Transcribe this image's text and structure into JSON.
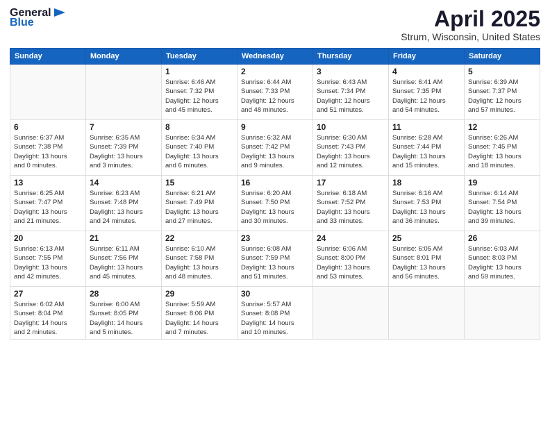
{
  "header": {
    "logo_general": "General",
    "logo_blue": "Blue",
    "title": "April 2025",
    "location": "Strum, Wisconsin, United States"
  },
  "weekdays": [
    "Sunday",
    "Monday",
    "Tuesday",
    "Wednesday",
    "Thursday",
    "Friday",
    "Saturday"
  ],
  "weeks": [
    [
      {
        "day": null,
        "info": null
      },
      {
        "day": null,
        "info": null
      },
      {
        "day": "1",
        "info": "Sunrise: 6:46 AM\nSunset: 7:32 PM\nDaylight: 12 hours\nand 45 minutes."
      },
      {
        "day": "2",
        "info": "Sunrise: 6:44 AM\nSunset: 7:33 PM\nDaylight: 12 hours\nand 48 minutes."
      },
      {
        "day": "3",
        "info": "Sunrise: 6:43 AM\nSunset: 7:34 PM\nDaylight: 12 hours\nand 51 minutes."
      },
      {
        "day": "4",
        "info": "Sunrise: 6:41 AM\nSunset: 7:35 PM\nDaylight: 12 hours\nand 54 minutes."
      },
      {
        "day": "5",
        "info": "Sunrise: 6:39 AM\nSunset: 7:37 PM\nDaylight: 12 hours\nand 57 minutes."
      }
    ],
    [
      {
        "day": "6",
        "info": "Sunrise: 6:37 AM\nSunset: 7:38 PM\nDaylight: 13 hours\nand 0 minutes."
      },
      {
        "day": "7",
        "info": "Sunrise: 6:35 AM\nSunset: 7:39 PM\nDaylight: 13 hours\nand 3 minutes."
      },
      {
        "day": "8",
        "info": "Sunrise: 6:34 AM\nSunset: 7:40 PM\nDaylight: 13 hours\nand 6 minutes."
      },
      {
        "day": "9",
        "info": "Sunrise: 6:32 AM\nSunset: 7:42 PM\nDaylight: 13 hours\nand 9 minutes."
      },
      {
        "day": "10",
        "info": "Sunrise: 6:30 AM\nSunset: 7:43 PM\nDaylight: 13 hours\nand 12 minutes."
      },
      {
        "day": "11",
        "info": "Sunrise: 6:28 AM\nSunset: 7:44 PM\nDaylight: 13 hours\nand 15 minutes."
      },
      {
        "day": "12",
        "info": "Sunrise: 6:26 AM\nSunset: 7:45 PM\nDaylight: 13 hours\nand 18 minutes."
      }
    ],
    [
      {
        "day": "13",
        "info": "Sunrise: 6:25 AM\nSunset: 7:47 PM\nDaylight: 13 hours\nand 21 minutes."
      },
      {
        "day": "14",
        "info": "Sunrise: 6:23 AM\nSunset: 7:48 PM\nDaylight: 13 hours\nand 24 minutes."
      },
      {
        "day": "15",
        "info": "Sunrise: 6:21 AM\nSunset: 7:49 PM\nDaylight: 13 hours\nand 27 minutes."
      },
      {
        "day": "16",
        "info": "Sunrise: 6:20 AM\nSunset: 7:50 PM\nDaylight: 13 hours\nand 30 minutes."
      },
      {
        "day": "17",
        "info": "Sunrise: 6:18 AM\nSunset: 7:52 PM\nDaylight: 13 hours\nand 33 minutes."
      },
      {
        "day": "18",
        "info": "Sunrise: 6:16 AM\nSunset: 7:53 PM\nDaylight: 13 hours\nand 36 minutes."
      },
      {
        "day": "19",
        "info": "Sunrise: 6:14 AM\nSunset: 7:54 PM\nDaylight: 13 hours\nand 39 minutes."
      }
    ],
    [
      {
        "day": "20",
        "info": "Sunrise: 6:13 AM\nSunset: 7:55 PM\nDaylight: 13 hours\nand 42 minutes."
      },
      {
        "day": "21",
        "info": "Sunrise: 6:11 AM\nSunset: 7:56 PM\nDaylight: 13 hours\nand 45 minutes."
      },
      {
        "day": "22",
        "info": "Sunrise: 6:10 AM\nSunset: 7:58 PM\nDaylight: 13 hours\nand 48 minutes."
      },
      {
        "day": "23",
        "info": "Sunrise: 6:08 AM\nSunset: 7:59 PM\nDaylight: 13 hours\nand 51 minutes."
      },
      {
        "day": "24",
        "info": "Sunrise: 6:06 AM\nSunset: 8:00 PM\nDaylight: 13 hours\nand 53 minutes."
      },
      {
        "day": "25",
        "info": "Sunrise: 6:05 AM\nSunset: 8:01 PM\nDaylight: 13 hours\nand 56 minutes."
      },
      {
        "day": "26",
        "info": "Sunrise: 6:03 AM\nSunset: 8:03 PM\nDaylight: 13 hours\nand 59 minutes."
      }
    ],
    [
      {
        "day": "27",
        "info": "Sunrise: 6:02 AM\nSunset: 8:04 PM\nDaylight: 14 hours\nand 2 minutes."
      },
      {
        "day": "28",
        "info": "Sunrise: 6:00 AM\nSunset: 8:05 PM\nDaylight: 14 hours\nand 5 minutes."
      },
      {
        "day": "29",
        "info": "Sunrise: 5:59 AM\nSunset: 8:06 PM\nDaylight: 14 hours\nand 7 minutes."
      },
      {
        "day": "30",
        "info": "Sunrise: 5:57 AM\nSunset: 8:08 PM\nDaylight: 14 hours\nand 10 minutes."
      },
      {
        "day": null,
        "info": null
      },
      {
        "day": null,
        "info": null
      },
      {
        "day": null,
        "info": null
      }
    ]
  ]
}
